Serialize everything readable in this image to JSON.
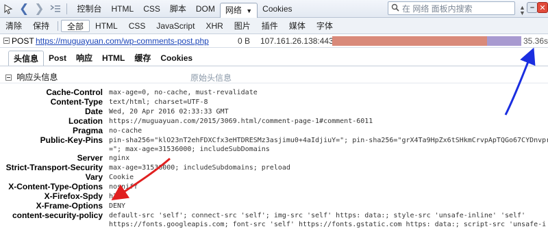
{
  "toolbar": {
    "tabs": [
      "控制台",
      "HTML",
      "CSS",
      "脚本",
      "DOM",
      "网络",
      "Cookies"
    ],
    "active_tab_index": 5,
    "search_placeholder": "在 网络 面板内搜索"
  },
  "filters": {
    "clear": "清除",
    "persist": "保持",
    "types": [
      "全部",
      "HTML",
      "CSS",
      "JavaScript",
      "XHR",
      "图片",
      "插件",
      "媒体",
      "字体"
    ],
    "active_index": 0
  },
  "request": {
    "method": "POST",
    "url": "https://muguayuan.com/wp-comments-post.php",
    "size": "0 B",
    "remote_ip": "107.161.26.138:443",
    "time": "35.36s"
  },
  "detail_tabs": [
    "头信息",
    "Post",
    "响应",
    "HTML",
    "缓存",
    "Cookies"
  ],
  "detail_active_index": 0,
  "section": {
    "title": "响应头信息",
    "raw_link": "原始头信息"
  },
  "headers": [
    {
      "name": "Cache-Control",
      "value": "max-age=0, no-cache, must-revalidate"
    },
    {
      "name": "Content-Type",
      "value": "text/html; charset=UTF-8"
    },
    {
      "name": "Date",
      "value": "Wed, 20 Apr 2016 02:33:33 GMT"
    },
    {
      "name": "Location",
      "value": "https://muguayuan.com/2015/3069.html/comment-page-1#comment-6011"
    },
    {
      "name": "Pragma",
      "value": "no-cache"
    },
    {
      "name": "Public-Key-Pins",
      "value": "pin-sha256=\"klO23nT2ehFDXCfx3eHTDRESMz3asjimu0+4aIdjiuY=\"; pin-sha256=\"grX4Ta9HpZx6tSHkmCrvpApTQGo67CYDnvpr",
      "value_line2": "=\"; max-age=31536000; includeSubDomains"
    },
    {
      "name": "Server",
      "value": "nginx"
    },
    {
      "name": "Strict-Transport-Security",
      "value": "max-age=31536000; includeSubdomains; preload"
    },
    {
      "name": "Vary",
      "value": "Cookie"
    },
    {
      "name": "X-Content-Type-Options",
      "value": "nosniff"
    },
    {
      "name": "X-Firefox-Spdy",
      "value": "h2"
    },
    {
      "name": "X-Frame-Options",
      "value": "DENY"
    },
    {
      "name": "content-security-policy",
      "value": "default-src 'self'; connect-src 'self'; img-src 'self' https: data:; style-src 'unsafe-inline' 'self'",
      "value_line2": "https://fonts.googleapis.com; font-src 'self' https://fonts.gstatic.com https: data:; script-src 'unsafe-i"
    }
  ],
  "colors": {
    "accent": "#4a6fb0",
    "timing_bar_blocked": "#d98a7a",
    "timing_bar_waiting": "#a89ad0",
    "annotation_red": "#e02020",
    "annotation_blue": "#1a2ee0",
    "url_link": "#1a44b8"
  },
  "icons": [
    "firebug-icon",
    "back-arrow-icon",
    "forward-arrow-icon",
    "console-list-icon",
    "dropdown-icon",
    "search-icon",
    "nav-up-icon",
    "nav-down-icon",
    "minimize-icon",
    "close-icon"
  ]
}
